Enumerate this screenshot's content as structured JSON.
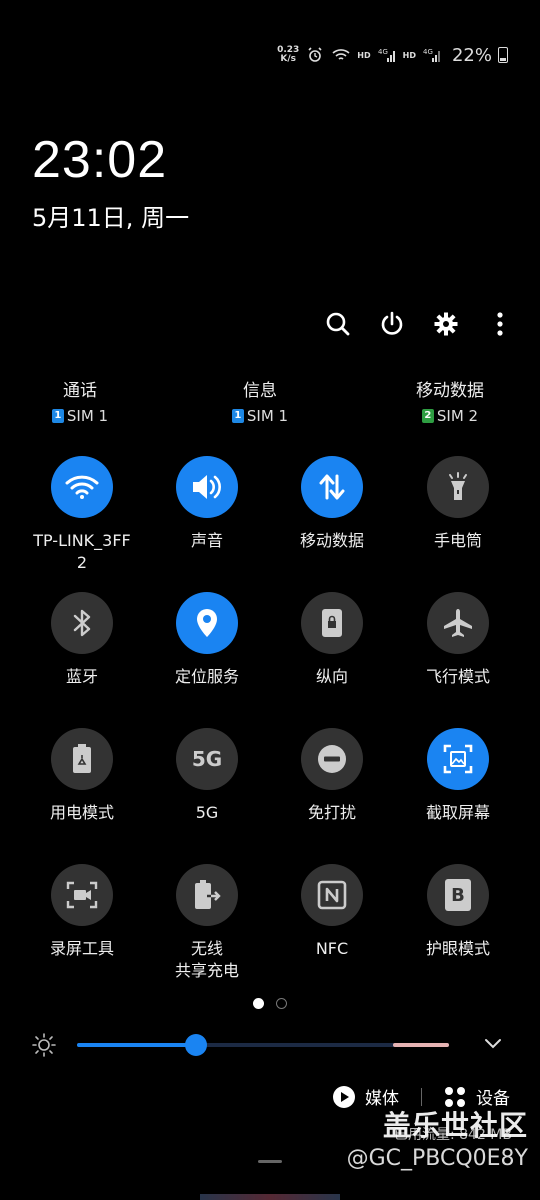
{
  "status": {
    "net_speed_value": "0.23",
    "net_speed_unit": "K/s",
    "icons": [
      "alarm-icon",
      "wifi-icon",
      "hd-icon",
      "signal-4g-icon",
      "hd-icon",
      "signal-4g-icon"
    ],
    "hd_label": "HD",
    "net_label": "4G",
    "battery": "22%"
  },
  "clock": {
    "time": "23:02",
    "date": "5月11日, 周一"
  },
  "actions": [
    "search-icon",
    "power-icon",
    "gear-icon",
    "more-icon"
  ],
  "sims": [
    {
      "label": "通话",
      "badge": "1",
      "sim": "SIM 1",
      "badge_color": "#1e88e5"
    },
    {
      "label": "信息",
      "badge": "1",
      "sim": "SIM 1",
      "badge_color": "#1e88e5"
    },
    {
      "label": "移动数据",
      "badge": "2",
      "sim": "SIM 2",
      "badge_color": "#2e9e42"
    }
  ],
  "tiles": [
    {
      "label": "TP-LINK_3FF\n2",
      "icon": "wifi-icon",
      "on": true
    },
    {
      "label": "声音",
      "icon": "speaker-icon",
      "on": true
    },
    {
      "label": "移动数据",
      "icon": "data-arrows-icon",
      "on": true
    },
    {
      "label": "手电筒",
      "icon": "flashlight-icon",
      "on": false
    },
    {
      "label": "蓝牙",
      "icon": "bluetooth-icon",
      "on": false
    },
    {
      "label": "定位服务",
      "icon": "location-icon",
      "on": true
    },
    {
      "label": "纵向",
      "icon": "portrait-lock-icon",
      "on": false
    },
    {
      "label": "飞行模式",
      "icon": "airplane-icon",
      "on": false
    },
    {
      "label": "用电模式",
      "icon": "battery-eco-icon",
      "on": false
    },
    {
      "label": "5G",
      "icon": "5g-icon",
      "icon_text": "5G",
      "on": false
    },
    {
      "label": "免打扰",
      "icon": "dnd-icon",
      "on": false
    },
    {
      "label": "截取屏幕",
      "icon": "screenshot-icon",
      "on": true
    },
    {
      "label": "录屏工具",
      "icon": "screen-record-icon",
      "on": false
    },
    {
      "label": "无线\n共享充电",
      "icon": "wireless-share-icon",
      "on": false
    },
    {
      "label": "NFC",
      "icon": "nfc-icon",
      "on": false
    },
    {
      "label": "护眼模式",
      "icon": "eye-comfort-icon",
      "icon_text": "B",
      "on": false
    }
  ],
  "pages": {
    "count": 2,
    "active": 1
  },
  "brightness": {
    "level": 0.32
  },
  "media": {
    "media_label": "媒体",
    "devices_label": "设备"
  },
  "data_usage": "已用流量: 842 MB",
  "watermark": {
    "brand": "盖乐世社区",
    "handle": "@GC_PBCQ0E8Y"
  },
  "colors": {
    "accent": "#1a84f2",
    "tile_off": "#333333",
    "background": "#000000"
  }
}
